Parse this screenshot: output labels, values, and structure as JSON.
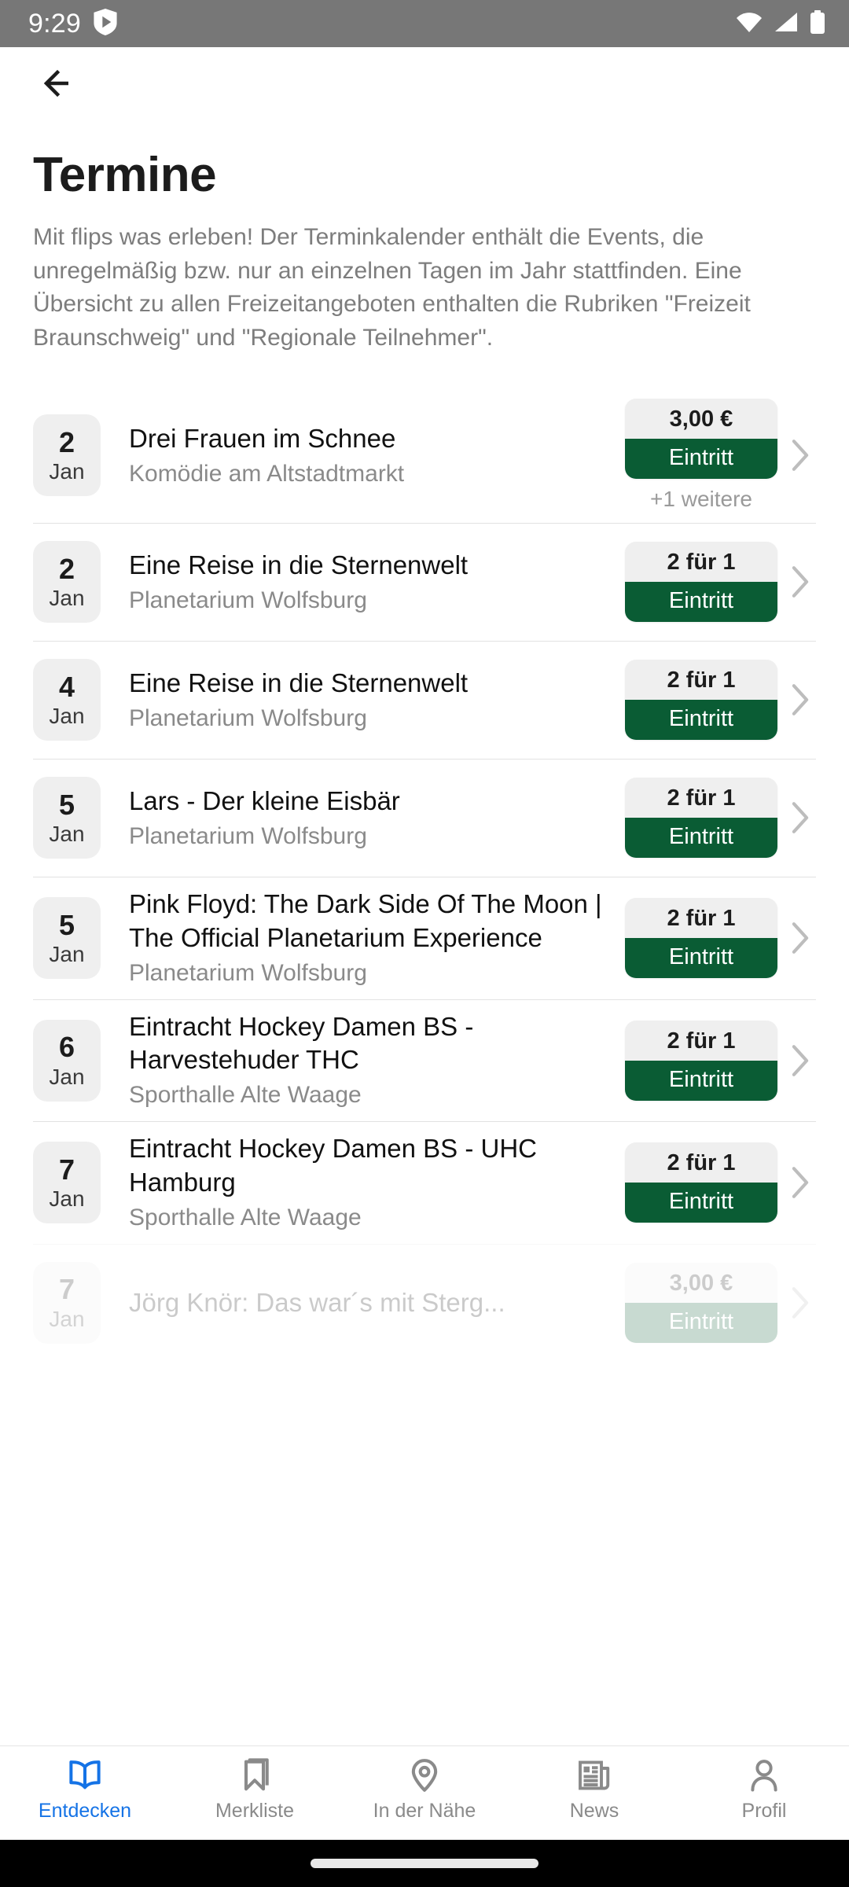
{
  "status_bar": {
    "time": "9:29",
    "icons_left": [
      "play-shield-icon"
    ],
    "icons_right": [
      "wifi-icon",
      "cellular-signal-icon",
      "battery-icon"
    ],
    "background_color": "#777777"
  },
  "topbar": {
    "back_icon": "arrow-left-icon"
  },
  "header": {
    "title": "Termine",
    "description": "Mit flips was erleben! Der Terminkalender enthält die Events, die unregelmäßig bzw. nur an einzelnen Tagen im Jahr stattfinden. Eine Übersicht zu allen Freizeitangeboten enthalten die Rubriken \"Freizeit Braunschweig\" und \"Regionale Teilnehmer\"."
  },
  "colors": {
    "badge_top_bg": "#efefef",
    "badge_bottom_bg": "#0a5c34",
    "accent_active": "#1573e6",
    "date_chip_bg": "#efefef",
    "divider": "#e2e2e2"
  },
  "events": [
    {
      "day": "2",
      "month": "Jan",
      "title": "Drei Frauen im Schnee",
      "venue": "Komödie am Altstadtmarkt",
      "badge_top": "3,00 €",
      "badge_bottom": "Eintritt",
      "extra": "+1 weitere"
    },
    {
      "day": "2",
      "month": "Jan",
      "title": "Eine Reise in die Sternenwelt",
      "venue": "Planetarium Wolfsburg",
      "badge_top": "2 für 1",
      "badge_bottom": "Eintritt",
      "extra": ""
    },
    {
      "day": "4",
      "month": "Jan",
      "title": "Eine Reise in die Sternenwelt",
      "venue": "Planetarium Wolfsburg",
      "badge_top": "2 für 1",
      "badge_bottom": "Eintritt",
      "extra": ""
    },
    {
      "day": "5",
      "month": "Jan",
      "title": "Lars - Der kleine Eisbär",
      "venue": "Planetarium Wolfsburg",
      "badge_top": "2 für 1",
      "badge_bottom": "Eintritt",
      "extra": ""
    },
    {
      "day": "5",
      "month": "Jan",
      "title": " Pink Floyd: The Dark Side Of The Moon | The Official Planetarium Experience",
      "venue": "Planetarium Wolfsburg",
      "badge_top": "2 für 1",
      "badge_bottom": "Eintritt",
      "extra": ""
    },
    {
      "day": "6",
      "month": "Jan",
      "title": "Eintracht Hockey Damen BS - Harvestehuder THC",
      "venue": "Sporthalle Alte Waage",
      "badge_top": "2 für 1",
      "badge_bottom": "Eintritt",
      "extra": ""
    },
    {
      "day": "7",
      "month": "Jan",
      "title": "Eintracht Hockey Damen BS - UHC Hamburg",
      "venue": "Sporthalle Alte Waage",
      "badge_top": "2 für 1",
      "badge_bottom": "Eintritt",
      "extra": ""
    },
    {
      "day": "7",
      "month": "Jan",
      "title": "Jörg Knör: Das war´s mit Sterg...",
      "venue": "",
      "badge_top": "3,00 €",
      "badge_bottom": "Eintritt",
      "extra": ""
    }
  ],
  "bottom_nav": [
    {
      "label": "Entdecken",
      "icon": "book-open-icon",
      "active": true
    },
    {
      "label": "Merkliste",
      "icon": "bookmark-icon",
      "active": false
    },
    {
      "label": "In der Nähe",
      "icon": "location-pin-icon",
      "active": false
    },
    {
      "label": "News",
      "icon": "newspaper-icon",
      "active": false
    },
    {
      "label": "Profil",
      "icon": "person-icon",
      "active": false
    }
  ]
}
